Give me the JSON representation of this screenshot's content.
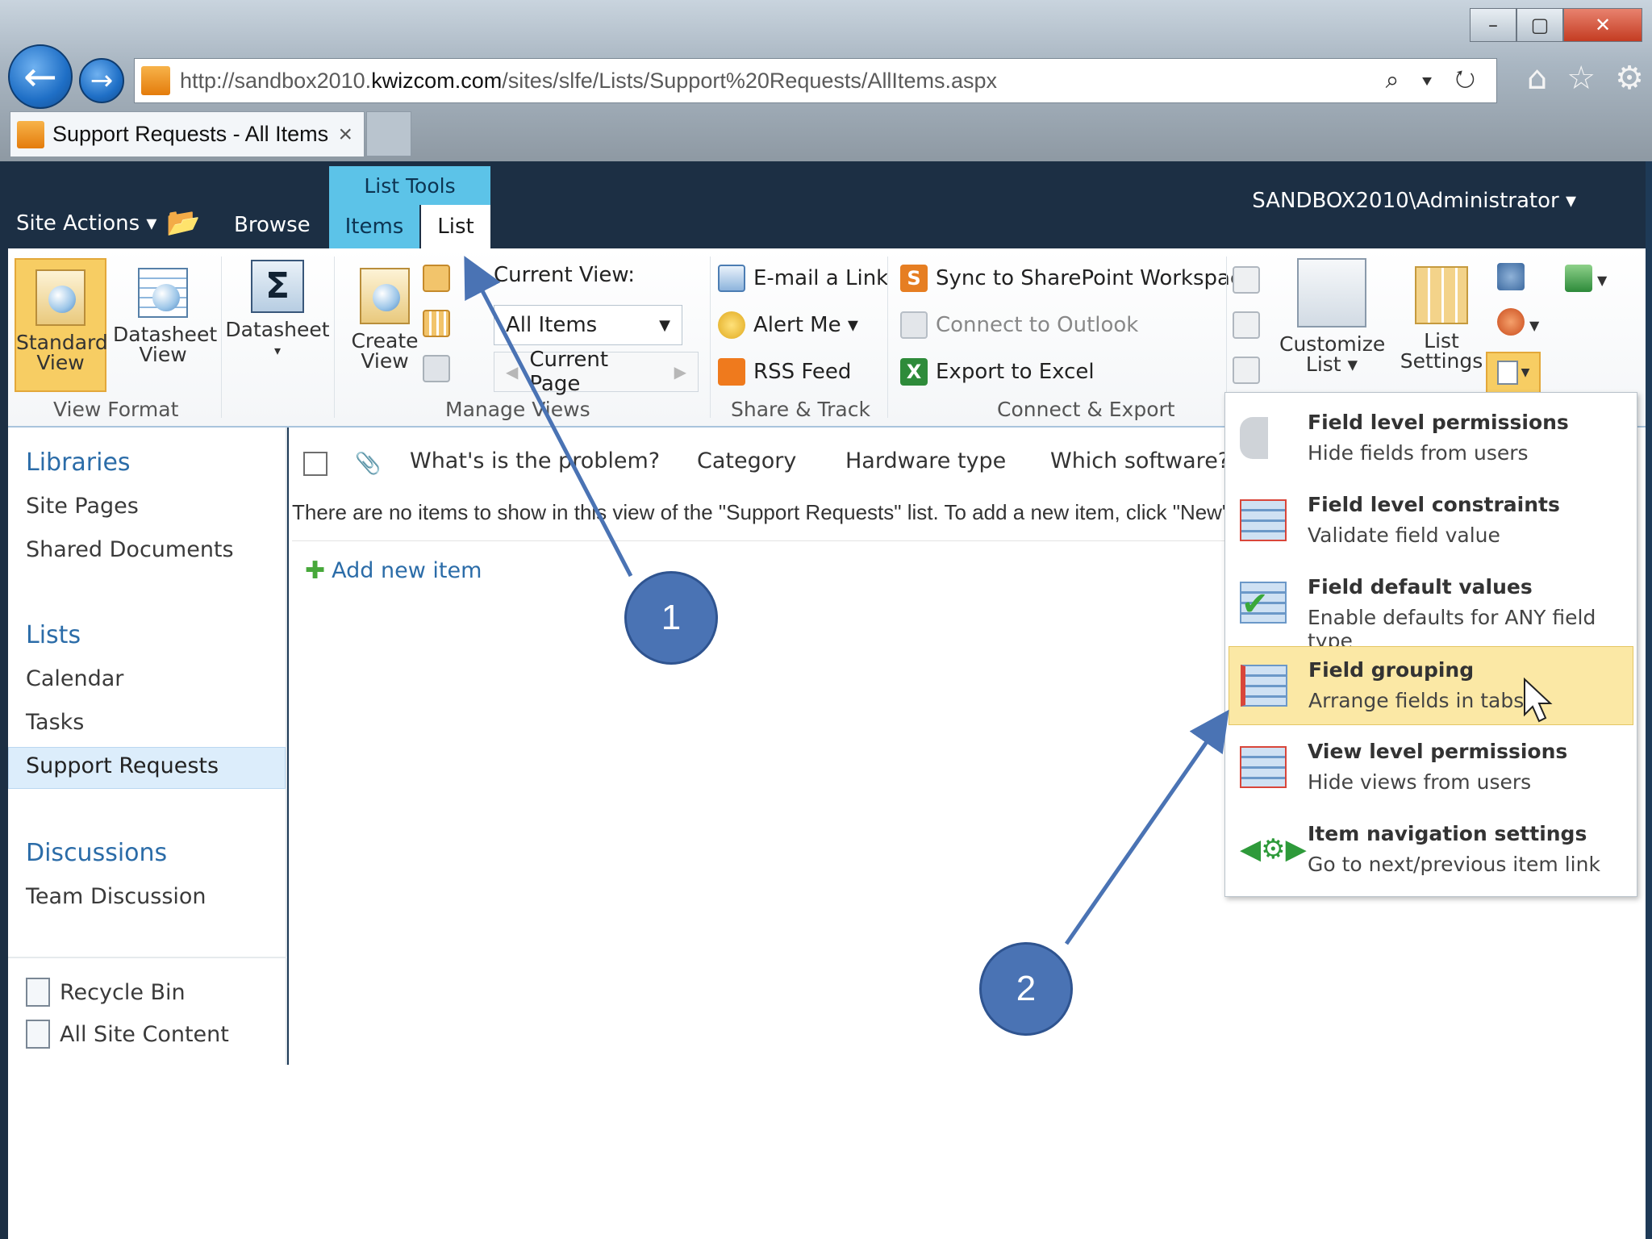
{
  "browser": {
    "url_prefix": "http://sandbox2010.",
    "url_domain": "kwizcom.com",
    "url_path": "/sites/slfe/Lists/Support%20Requests/AllItems.aspx",
    "address_tools": "⌕ ▾ ↻",
    "tab_title": "Support Requests - All Items",
    "tab_close": "×",
    "window_buttons": {
      "minimize": "–",
      "maximize": "▢",
      "close": "✕"
    },
    "toolbar_icons": {
      "home": "⌂",
      "favorites": "☆",
      "settings": "⚙"
    }
  },
  "header": {
    "site_actions": "Site Actions ▾",
    "browse_tab": "Browse",
    "contextual_group": "List Tools",
    "items_tab": "Items",
    "list_tab": "List",
    "user": "SANDBOX2010\\Administrator ▾"
  },
  "ribbon": {
    "standard_view": [
      "Standard",
      "View"
    ],
    "datasheet_view": [
      "Datasheet",
      "View"
    ],
    "datasheet": "Datasheet",
    "datasheet_arrow": "▾",
    "view_format_label": "View Format",
    "create_view": [
      "Create",
      "View"
    ],
    "current_view_label": "Current View:",
    "current_view_value": "All Items",
    "current_page": "Current Page",
    "manage_views_label": "Manage Views",
    "email_link": "E-mail a Link",
    "alert_me": "Alert Me ▾",
    "rss_feed": "RSS Feed",
    "share_track_label": "Share & Track",
    "sync_workspace": "Sync to SharePoint Workspace",
    "connect_outlook": "Connect to Outlook",
    "export_excel": "Export to Excel",
    "connect_export_label": "Connect & Export",
    "customize_list": [
      "Customize",
      "List ▾"
    ],
    "list_settings": [
      "List",
      "Settings"
    ]
  },
  "leftnav": {
    "libraries": "Libraries",
    "site_pages": "Site Pages",
    "shared_documents": "Shared Documents",
    "lists": "Lists",
    "calendar": "Calendar",
    "tasks": "Tasks",
    "support_requests": "Support Requests",
    "discussions": "Discussions",
    "team_discussion": "Team Discussion",
    "recycle_bin": "Recycle Bin",
    "all_site_content": "All Site Content"
  },
  "list": {
    "columns": [
      "What's is the problem?",
      "Category",
      "Hardware type",
      "Which software?"
    ],
    "empty_message": "There are no items to show in this view of the \"Support Requests\" list. To add a new item, click \"New\".",
    "add_new_item": "Add new item"
  },
  "menu": {
    "items": [
      {
        "title": "Field level permissions",
        "subtitle": "Hide fields from users"
      },
      {
        "title": "Field level constraints",
        "subtitle": "Validate field value"
      },
      {
        "title": "Field default values",
        "subtitle": "Enable defaults for ANY field type"
      },
      {
        "title": "Field grouping",
        "subtitle": "Arrange fields in tabs"
      },
      {
        "title": "View level permissions",
        "subtitle": "Hide views from users"
      },
      {
        "title": "Item navigation settings",
        "subtitle": "Go to next/previous item link"
      }
    ]
  },
  "callouts": {
    "one": "1",
    "two": "2"
  },
  "colors": {
    "header_bg": "#1c2f44",
    "context_tab": "#5cc3e8",
    "selected_button": "#f7cd63",
    "menu_highlight": "#fbe8a5",
    "callout": "#4a73b4",
    "link": "#2b6ca8"
  }
}
